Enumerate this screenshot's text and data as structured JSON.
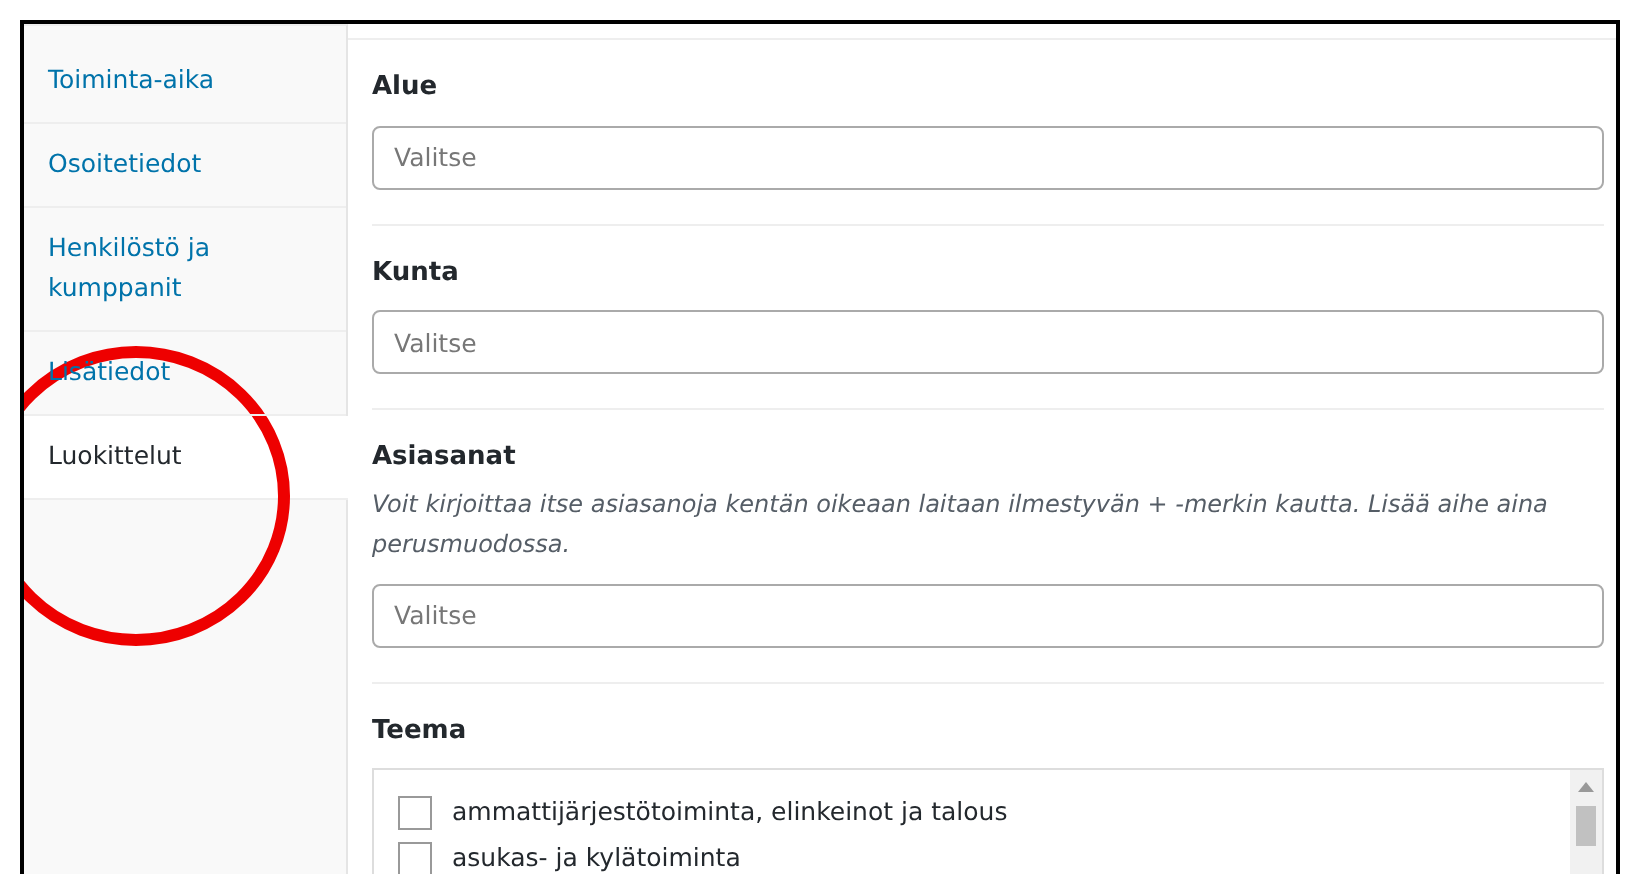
{
  "sidebar": {
    "items": [
      {
        "label": "Toiminta-aika",
        "selected": false
      },
      {
        "label": "Osoitetiedot",
        "selected": false
      },
      {
        "label": "Henkilöstö ja kumppanit",
        "selected": false
      },
      {
        "label": "Lisätiedot",
        "selected": false
      },
      {
        "label": "Luokittelut",
        "selected": true
      }
    ]
  },
  "sections": [
    {
      "kind": "select",
      "label": "Alue",
      "placeholder": "Valitse"
    },
    {
      "kind": "select",
      "label": "Kunta",
      "placeholder": "Valitse"
    },
    {
      "kind": "select",
      "label": "Asiasanat",
      "description": "Voit kirjoittaa itse asiasanoja kentän oikeaan laitaan ilmestyvän + -merkin kautta. Lisää aihe aina perusmuodossa.",
      "placeholder": "Valitse"
    },
    {
      "kind": "checklist",
      "label": "Teema",
      "options": [
        {
          "label": "ammattijärjestötoiminta, elinkeinot ja talous",
          "checked": false
        },
        {
          "label": "asukas- ja kylätoiminta",
          "checked": false
        }
      ]
    }
  ]
}
